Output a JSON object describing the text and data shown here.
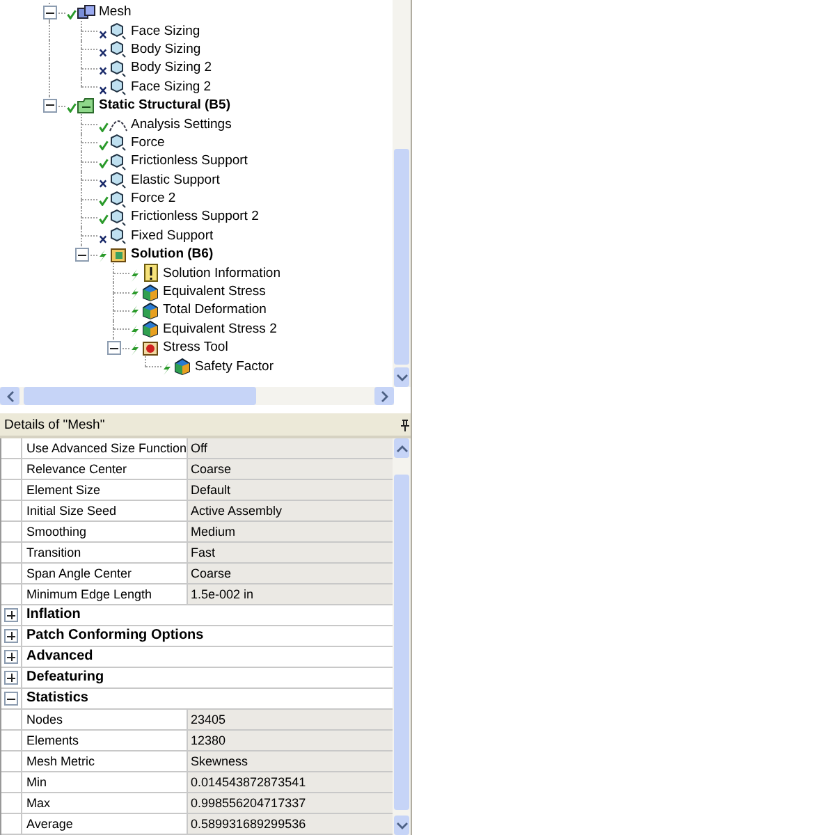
{
  "tree": [
    {
      "label": "Mesh",
      "kind": "mesh",
      "defined": true,
      "solved": false,
      "expanded": true,
      "children": [
        {
          "label": "Face Sizing",
          "kind": "item",
          "defined": false,
          "solved": false
        },
        {
          "label": "Body Sizing",
          "kind": "item",
          "defined": false,
          "solved": false
        },
        {
          "label": "Body Sizing 2",
          "kind": "item",
          "defined": false,
          "solved": false
        },
        {
          "label": "Face Sizing 2",
          "kind": "item",
          "defined": false,
          "solved": false
        }
      ]
    },
    {
      "label": "Static Structural (B5)",
      "kind": "analysis",
      "defined": true,
      "solved": false,
      "expanded": true,
      "children": [
        {
          "label": "Analysis Settings",
          "kind": "settings",
          "defined": true,
          "solved": false
        },
        {
          "label": "Force",
          "kind": "item",
          "defined": true,
          "solved": false
        },
        {
          "label": "Frictionless Support",
          "kind": "item",
          "defined": true,
          "solved": false
        },
        {
          "label": "Elastic Support",
          "kind": "item",
          "defined": false,
          "solved": false
        },
        {
          "label": "Force 2",
          "kind": "item",
          "defined": true,
          "solved": false
        },
        {
          "label": "Frictionless Support 2",
          "kind": "item",
          "defined": true,
          "solved": false
        },
        {
          "label": "Fixed Support",
          "kind": "item",
          "defined": false,
          "solved": false
        },
        {
          "label": "Solution (B6)",
          "kind": "solution",
          "defined": true,
          "solved": true,
          "expanded": true,
          "children": [
            {
              "label": "Solution Information",
              "kind": "info",
              "defined": true,
              "solved": true
            },
            {
              "label": "Equivalent Stress",
              "kind": "result",
              "defined": true,
              "solved": true
            },
            {
              "label": "Total Deformation",
              "kind": "result",
              "defined": true,
              "solved": true
            },
            {
              "label": "Equivalent Stress 2",
              "kind": "result",
              "defined": true,
              "solved": true
            },
            {
              "label": "Stress Tool",
              "kind": "tool",
              "defined": true,
              "solved": true,
              "expanded": true,
              "children": [
                {
                  "label": "Safety Factor",
                  "kind": "result",
                  "defined": true,
                  "solved": true
                }
              ]
            }
          ]
        }
      ]
    }
  ],
  "details": {
    "title": "Details of \"Mesh\"",
    "rows": [
      {
        "kind": "property",
        "label": "Use Advanced Size Function",
        "value": "Off"
      },
      {
        "kind": "property",
        "label": "Relevance Center",
        "value": "Coarse"
      },
      {
        "kind": "property",
        "label": "Element Size",
        "value": "Default"
      },
      {
        "kind": "property",
        "label": "Initial Size Seed",
        "value": "Active Assembly"
      },
      {
        "kind": "property",
        "label": "Smoothing",
        "value": "Medium"
      },
      {
        "kind": "property",
        "label": "Transition",
        "value": "Fast"
      },
      {
        "kind": "property",
        "label": "Span Angle Center",
        "value": "Coarse"
      },
      {
        "kind": "property",
        "label": "Minimum Edge Length",
        "value": "1.5e-002 in"
      },
      {
        "kind": "group",
        "label": "Inflation",
        "expanded": false
      },
      {
        "kind": "group",
        "label": "Patch Conforming Options",
        "expanded": false
      },
      {
        "kind": "group",
        "label": "Advanced",
        "expanded": false
      },
      {
        "kind": "group",
        "label": "Defeaturing",
        "expanded": false
      },
      {
        "kind": "group",
        "label": "Statistics",
        "expanded": true
      },
      {
        "kind": "property",
        "label": "Nodes",
        "value": "23405"
      },
      {
        "kind": "property",
        "label": "Elements",
        "value": "12380"
      },
      {
        "kind": "property",
        "label": "Mesh Metric",
        "value": "Skewness"
      },
      {
        "kind": "property",
        "label": "Min",
        "value": "0.014543872873541"
      },
      {
        "kind": "property",
        "label": "Max",
        "value": "0.998556204717337"
      },
      {
        "kind": "property",
        "label": "Average",
        "value": "0.589931689299536"
      }
    ]
  }
}
